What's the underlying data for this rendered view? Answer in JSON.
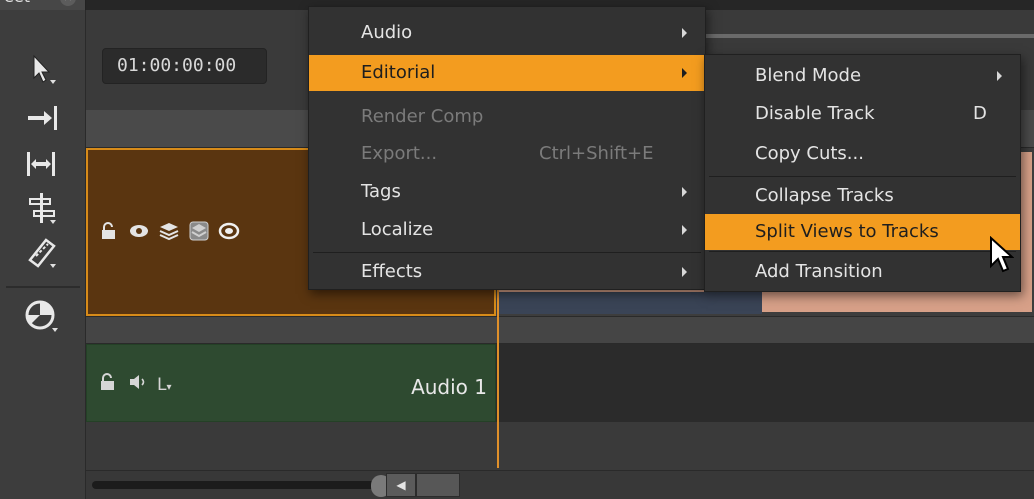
{
  "window": {
    "tab_label": "eet"
  },
  "timeline": {
    "timecode": "01:00:00:00",
    "audio_track_name": "Audio 1",
    "audio_channel_label": "L"
  },
  "context_menu": {
    "items": [
      {
        "label": "Audio",
        "shortcut": "",
        "has_submenu": true,
        "enabled": true,
        "highlighted": false
      },
      {
        "label": "Editorial",
        "shortcut": "",
        "has_submenu": true,
        "enabled": true,
        "highlighted": true
      },
      {
        "label": "Render Comp",
        "shortcut": "",
        "has_submenu": false,
        "enabled": false,
        "highlighted": false
      },
      {
        "label": "Export...",
        "shortcut": "Ctrl+Shift+E",
        "has_submenu": false,
        "enabled": false,
        "highlighted": false
      },
      {
        "label": "Tags",
        "shortcut": "",
        "has_submenu": true,
        "enabled": true,
        "highlighted": false
      },
      {
        "label": "Localize",
        "shortcut": "",
        "has_submenu": true,
        "enabled": true,
        "highlighted": false
      },
      {
        "label": "Effects",
        "shortcut": "",
        "has_submenu": true,
        "enabled": true,
        "highlighted": false
      }
    ]
  },
  "editorial_submenu": {
    "items": [
      {
        "label": "Blend Mode",
        "shortcut": "",
        "has_submenu": true,
        "highlighted": false
      },
      {
        "label": "Disable Track",
        "shortcut": "D",
        "has_submenu": false,
        "highlighted": false
      },
      {
        "label": "Copy Cuts...",
        "shortcut": "",
        "has_submenu": false,
        "highlighted": false
      },
      {
        "label": "Collapse Tracks",
        "shortcut": "",
        "has_submenu": false,
        "highlighted": false
      },
      {
        "label": "Split Views to Tracks",
        "shortcut": "",
        "has_submenu": false,
        "highlighted": true
      },
      {
        "label": "Add Transition",
        "shortcut": "",
        "has_submenu": false,
        "highlighted": false
      }
    ]
  },
  "colors": {
    "menu_highlight": "#f39c1f",
    "video_track_header": "#5a3510",
    "video_track_border": "#d78b19",
    "audio_track_header": "#2e4a30",
    "clip_color": "#d7a088",
    "playhead": "#e0902a"
  },
  "icons": {
    "toolbar": [
      "select-arrow-icon",
      "track-forward-icon",
      "slip-clip-icon",
      "align-tracks-icon",
      "razor-icon",
      "viewer-wipe-icon"
    ],
    "video_track": [
      "lock-icon",
      "eye-icon",
      "layers-icon",
      "blend-icon",
      "mute-icon"
    ],
    "audio_track": [
      "lock-icon",
      "speaker-icon"
    ]
  }
}
